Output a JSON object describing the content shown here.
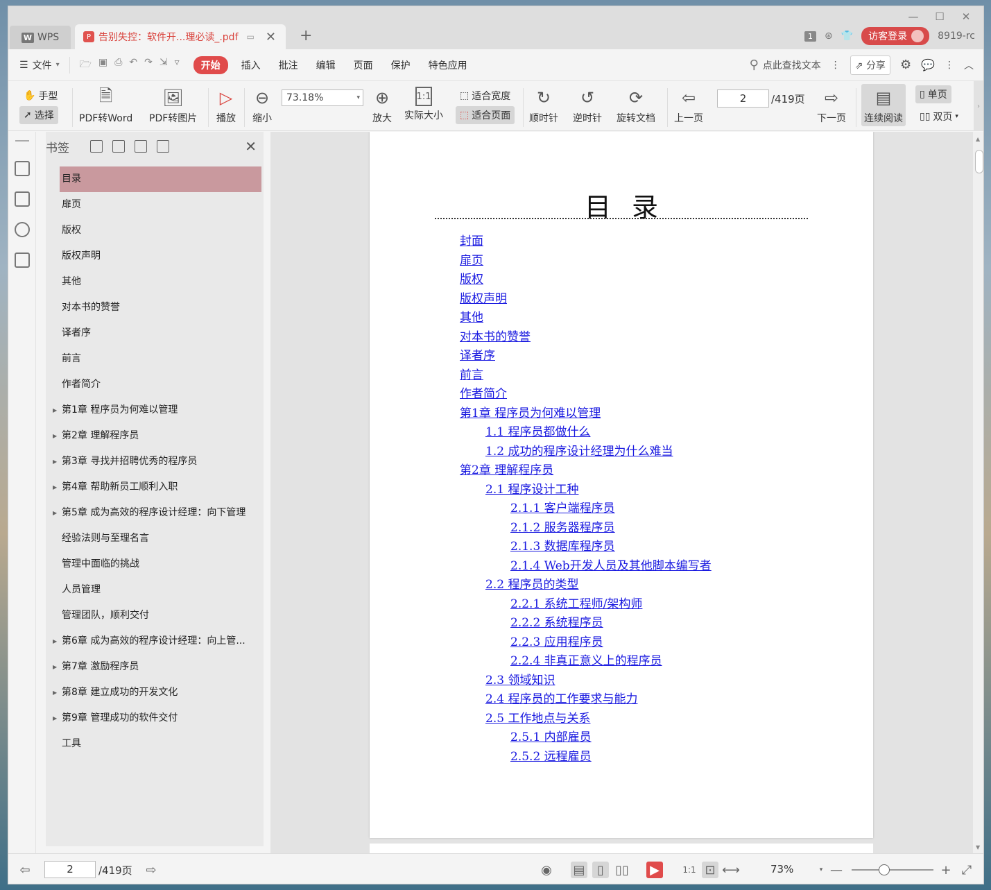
{
  "titlebar": {
    "home_tab": "WPS",
    "home_logo": "W",
    "doc_tab_title": "告别失控：软件开...理必读_.pdf",
    "user_badge": "1",
    "login_label": "访客登录",
    "user_code": "8919-rc"
  },
  "menubar": {
    "file_label": "文件",
    "items": [
      "开始",
      "插入",
      "批注",
      "编辑",
      "页面",
      "保护",
      "特色应用"
    ],
    "search_label": "点此查找文本",
    "share_label": "分享"
  },
  "toolbar": {
    "hand_label": "手型",
    "select_label": "选择",
    "pdf_to_word": "PDF转Word",
    "pdf_to_image": "PDF转图片",
    "play": "播放",
    "zoom_out": "缩小",
    "zoom_value": "73.18%",
    "zoom_in": "放大",
    "actual_size": "实际大小",
    "fit_width": "适合宽度",
    "fit_page": "适合页面",
    "clockwise": "顺时针",
    "counterclockwise": "逆时针",
    "rotate_doc": "旋转文档",
    "prev_page": "上一页",
    "page_current": "2",
    "page_total": "/419页",
    "next_page": "下一页",
    "continuous": "连续阅读",
    "single": "单页",
    "double": "双页"
  },
  "bookmarks": {
    "title": "书签",
    "items": [
      {
        "label": "目录",
        "arrow": false,
        "selected": true
      },
      {
        "label": "扉页",
        "arrow": false
      },
      {
        "label": "版权",
        "arrow": false
      },
      {
        "label": "版权声明",
        "arrow": false
      },
      {
        "label": "其他",
        "arrow": false
      },
      {
        "label": "对本书的赞誉",
        "arrow": false
      },
      {
        "label": "译者序",
        "arrow": false
      },
      {
        "label": "前言",
        "arrow": false
      },
      {
        "label": "作者简介",
        "arrow": false
      },
      {
        "label": "第1章 程序员为何难以管理",
        "arrow": true
      },
      {
        "label": "第2章 理解程序员",
        "arrow": true
      },
      {
        "label": "第3章 寻找并招聘优秀的程序员",
        "arrow": true
      },
      {
        "label": "第4章 帮助新员工顺利入职",
        "arrow": true
      },
      {
        "label": "第5章 成为高效的程序设计经理：向下管理",
        "arrow": true
      },
      {
        "label": "经验法则与至理名言",
        "arrow": false
      },
      {
        "label": "管理中面临的挑战",
        "arrow": false
      },
      {
        "label": "人员管理",
        "arrow": false
      },
      {
        "label": "管理团队，顺利交付",
        "arrow": false
      },
      {
        "label": "第6章 成为高效的程序设计经理：向上管...",
        "arrow": true
      },
      {
        "label": "第7章 激励程序员",
        "arrow": true
      },
      {
        "label": "第8章 建立成功的开发文化",
        "arrow": true
      },
      {
        "label": "第9章 管理成功的软件交付",
        "arrow": true
      },
      {
        "label": "工具",
        "arrow": false
      }
    ]
  },
  "document": {
    "title": "目录",
    "toc": [
      {
        "text": "封面",
        "level": 1
      },
      {
        "text": "扉页",
        "level": 1
      },
      {
        "text": "版权",
        "level": 1
      },
      {
        "text": "版权声明",
        "level": 1
      },
      {
        "text": "其他",
        "level": 1
      },
      {
        "text": "对本书的赞誉",
        "level": 1
      },
      {
        "text": "译者序",
        "level": 1
      },
      {
        "text": "前言",
        "level": 1
      },
      {
        "text": "作者简介",
        "level": 1
      },
      {
        "text": "第1章 程序员为何难以管理",
        "level": 1
      },
      {
        "text": "1.1 程序员都做什么",
        "level": 2
      },
      {
        "text": "1.2 成功的程序设计经理为什么难当",
        "level": 2
      },
      {
        "text": "第2章 理解程序员",
        "level": 1
      },
      {
        "text": "2.1 程序设计工种",
        "level": 2
      },
      {
        "text": "2.1.1 客户端程序员",
        "level": 3
      },
      {
        "text": "2.1.2 服务器程序员",
        "level": 3
      },
      {
        "text": "2.1.3 数据库程序员",
        "level": 3
      },
      {
        "text": "2.1.4 Web开发人员及其他脚本编写者",
        "level": 3
      },
      {
        "text": "2.2 程序员的类型",
        "level": 2
      },
      {
        "text": "2.2.1 系统工程师/架构师",
        "level": 3
      },
      {
        "text": "2.2.2 系统程序员",
        "level": 3
      },
      {
        "text": "2.2.3 应用程序员",
        "level": 3
      },
      {
        "text": "2.2.4 非真正意义上的程序员",
        "level": 3
      },
      {
        "text": "2.3 领域知识",
        "level": 2
      },
      {
        "text": "2.4 程序员的工作要求与能力",
        "level": 2
      },
      {
        "text": "2.5 工作地点与关系",
        "level": 2
      },
      {
        "text": "2.5.1 内部雇员",
        "level": 3
      },
      {
        "text": "2.5.2 远程雇员",
        "level": 3
      }
    ]
  },
  "statusbar": {
    "page_current": "2",
    "page_total": "/419页",
    "zoom": "73%",
    "zoom_fraction": 0.4
  },
  "colors": {
    "accent": "#e04b4b",
    "bookmark_selected": "#c9999e",
    "link": "#1a1ae0"
  }
}
